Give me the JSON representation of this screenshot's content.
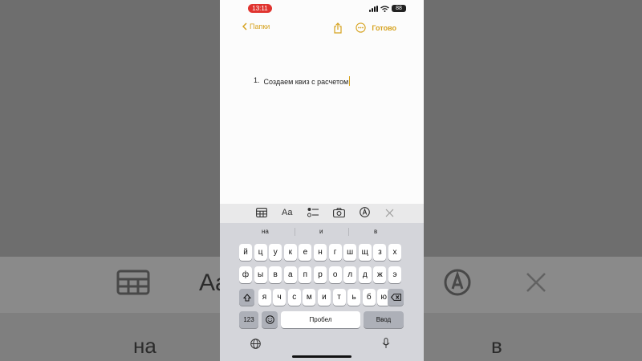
{
  "status": {
    "time": "13:11",
    "battery": "88"
  },
  "nav": {
    "back_label": "Папки",
    "done_label": "Готово"
  },
  "note": {
    "list_number": "1.",
    "text": "Создаем квиз с расчетом"
  },
  "suggestions": [
    "на",
    "и",
    "в"
  ],
  "keyboard": {
    "row1": [
      "й",
      "ц",
      "у",
      "к",
      "е",
      "н",
      "г",
      "ш",
      "щ",
      "з",
      "х"
    ],
    "row2": [
      "ф",
      "ы",
      "в",
      "а",
      "п",
      "р",
      "о",
      "л",
      "д",
      "ж",
      "э"
    ],
    "row3": [
      "я",
      "ч",
      "с",
      "м",
      "и",
      "т",
      "ь",
      "б",
      "ю"
    ],
    "numbers_label": "123",
    "space_label": "Пробел",
    "return_label": "Ввод"
  },
  "background": {
    "suggestion_left": "на",
    "suggestion_right": "в",
    "format_label": "Aa"
  },
  "icons": {
    "toolbar": [
      "table-icon",
      "text-format-icon",
      "checklist-icon",
      "camera-icon",
      "markup-icon",
      "close-icon"
    ],
    "nav": [
      "share-icon",
      "more-icon"
    ],
    "keyboard": [
      "shift-icon",
      "delete-icon",
      "emoji-icon",
      "globe-icon",
      "microphone-icon"
    ]
  },
  "colors": {
    "accent": "#d6a21e",
    "recording": "#e0342f",
    "keyboard_bg": "#d4d5da"
  }
}
